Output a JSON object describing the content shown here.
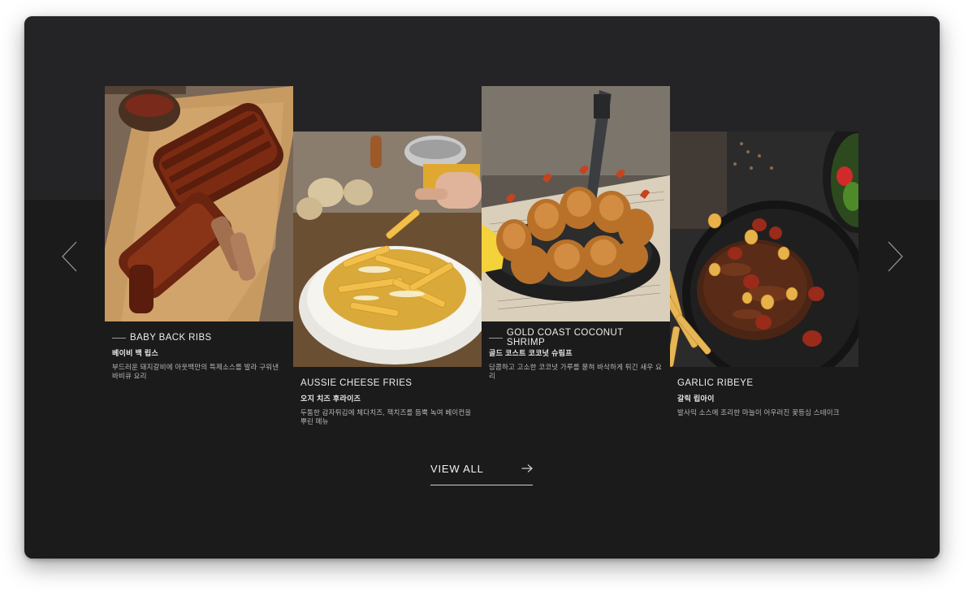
{
  "carousel": {
    "prev_icon": "chevron-left-icon",
    "next_icon": "chevron-right-icon",
    "items": [
      {
        "title": "BABY BACK RIBS",
        "subtitle": "베이비 백 립스",
        "description": "부드러운 돼지갈비에 아웃백만의 특제소스를 발라 구워낸 바비큐 요리"
      },
      {
        "title": "AUSSIE CHEESE FRIES",
        "subtitle": "오지 치즈 후라이즈",
        "description": "두툼한 감자튀김에 체다치즈, 잭치즈를 듬뿍 녹여 베이컨을 뿌린 메뉴"
      },
      {
        "title": "GOLD COAST COCONUT SHRIMP",
        "subtitle": "골드 코스트 코코넛 슈림프",
        "description": "담콤하고 고소한 코코넛 가루를 묻혀 바삭하게 튀긴 새우 요리"
      },
      {
        "title": "GARLIC RIBEYE",
        "subtitle": "갈릭 립아이",
        "description": "발사믹 소스에 조리한 마늘이 어우러진 꽃등심 스테이크"
      }
    ]
  },
  "view_all": {
    "label": "VIEW ALL",
    "icon": "arrow-right-icon"
  },
  "colors": {
    "frame_bg": "#1c1c1d",
    "top_band": "#242426",
    "text_primary": "#ececec",
    "text_secondary": "#b8b8b8"
  }
}
